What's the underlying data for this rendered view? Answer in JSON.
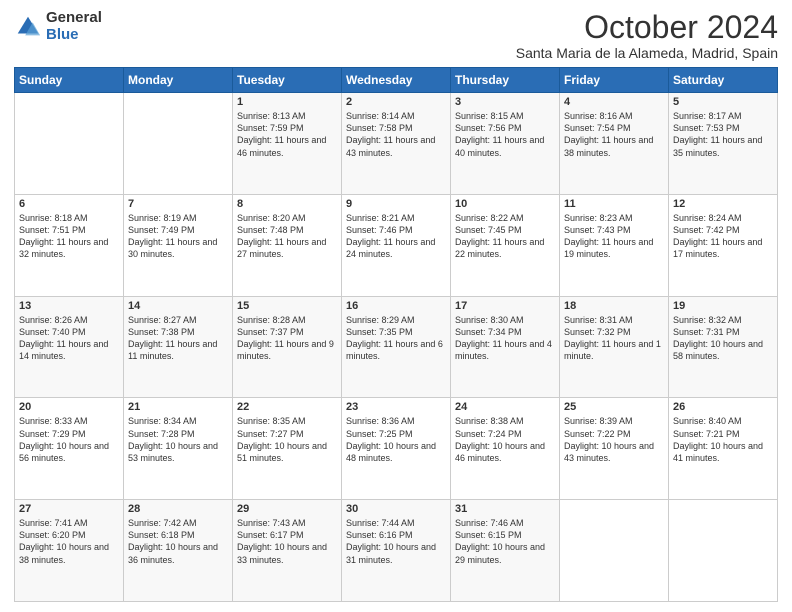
{
  "logo": {
    "general": "General",
    "blue": "Blue"
  },
  "header": {
    "month": "October 2024",
    "location": "Santa Maria de la Alameda, Madrid, Spain"
  },
  "weekdays": [
    "Sunday",
    "Monday",
    "Tuesday",
    "Wednesday",
    "Thursday",
    "Friday",
    "Saturday"
  ],
  "weeks": [
    [
      {
        "day": "",
        "info": ""
      },
      {
        "day": "",
        "info": ""
      },
      {
        "day": "1",
        "info": "Sunrise: 8:13 AM\nSunset: 7:59 PM\nDaylight: 11 hours and 46 minutes."
      },
      {
        "day": "2",
        "info": "Sunrise: 8:14 AM\nSunset: 7:58 PM\nDaylight: 11 hours and 43 minutes."
      },
      {
        "day": "3",
        "info": "Sunrise: 8:15 AM\nSunset: 7:56 PM\nDaylight: 11 hours and 40 minutes."
      },
      {
        "day": "4",
        "info": "Sunrise: 8:16 AM\nSunset: 7:54 PM\nDaylight: 11 hours and 38 minutes."
      },
      {
        "day": "5",
        "info": "Sunrise: 8:17 AM\nSunset: 7:53 PM\nDaylight: 11 hours and 35 minutes."
      }
    ],
    [
      {
        "day": "6",
        "info": "Sunrise: 8:18 AM\nSunset: 7:51 PM\nDaylight: 11 hours and 32 minutes."
      },
      {
        "day": "7",
        "info": "Sunrise: 8:19 AM\nSunset: 7:49 PM\nDaylight: 11 hours and 30 minutes."
      },
      {
        "day": "8",
        "info": "Sunrise: 8:20 AM\nSunset: 7:48 PM\nDaylight: 11 hours and 27 minutes."
      },
      {
        "day": "9",
        "info": "Sunrise: 8:21 AM\nSunset: 7:46 PM\nDaylight: 11 hours and 24 minutes."
      },
      {
        "day": "10",
        "info": "Sunrise: 8:22 AM\nSunset: 7:45 PM\nDaylight: 11 hours and 22 minutes."
      },
      {
        "day": "11",
        "info": "Sunrise: 8:23 AM\nSunset: 7:43 PM\nDaylight: 11 hours and 19 minutes."
      },
      {
        "day": "12",
        "info": "Sunrise: 8:24 AM\nSunset: 7:42 PM\nDaylight: 11 hours and 17 minutes."
      }
    ],
    [
      {
        "day": "13",
        "info": "Sunrise: 8:26 AM\nSunset: 7:40 PM\nDaylight: 11 hours and 14 minutes."
      },
      {
        "day": "14",
        "info": "Sunrise: 8:27 AM\nSunset: 7:38 PM\nDaylight: 11 hours and 11 minutes."
      },
      {
        "day": "15",
        "info": "Sunrise: 8:28 AM\nSunset: 7:37 PM\nDaylight: 11 hours and 9 minutes."
      },
      {
        "day": "16",
        "info": "Sunrise: 8:29 AM\nSunset: 7:35 PM\nDaylight: 11 hours and 6 minutes."
      },
      {
        "day": "17",
        "info": "Sunrise: 8:30 AM\nSunset: 7:34 PM\nDaylight: 11 hours and 4 minutes."
      },
      {
        "day": "18",
        "info": "Sunrise: 8:31 AM\nSunset: 7:32 PM\nDaylight: 11 hours and 1 minute."
      },
      {
        "day": "19",
        "info": "Sunrise: 8:32 AM\nSunset: 7:31 PM\nDaylight: 10 hours and 58 minutes."
      }
    ],
    [
      {
        "day": "20",
        "info": "Sunrise: 8:33 AM\nSunset: 7:29 PM\nDaylight: 10 hours and 56 minutes."
      },
      {
        "day": "21",
        "info": "Sunrise: 8:34 AM\nSunset: 7:28 PM\nDaylight: 10 hours and 53 minutes."
      },
      {
        "day": "22",
        "info": "Sunrise: 8:35 AM\nSunset: 7:27 PM\nDaylight: 10 hours and 51 minutes."
      },
      {
        "day": "23",
        "info": "Sunrise: 8:36 AM\nSunset: 7:25 PM\nDaylight: 10 hours and 48 minutes."
      },
      {
        "day": "24",
        "info": "Sunrise: 8:38 AM\nSunset: 7:24 PM\nDaylight: 10 hours and 46 minutes."
      },
      {
        "day": "25",
        "info": "Sunrise: 8:39 AM\nSunset: 7:22 PM\nDaylight: 10 hours and 43 minutes."
      },
      {
        "day": "26",
        "info": "Sunrise: 8:40 AM\nSunset: 7:21 PM\nDaylight: 10 hours and 41 minutes."
      }
    ],
    [
      {
        "day": "27",
        "info": "Sunrise: 7:41 AM\nSunset: 6:20 PM\nDaylight: 10 hours and 38 minutes."
      },
      {
        "day": "28",
        "info": "Sunrise: 7:42 AM\nSunset: 6:18 PM\nDaylight: 10 hours and 36 minutes."
      },
      {
        "day": "29",
        "info": "Sunrise: 7:43 AM\nSunset: 6:17 PM\nDaylight: 10 hours and 33 minutes."
      },
      {
        "day": "30",
        "info": "Sunrise: 7:44 AM\nSunset: 6:16 PM\nDaylight: 10 hours and 31 minutes."
      },
      {
        "day": "31",
        "info": "Sunrise: 7:46 AM\nSunset: 6:15 PM\nDaylight: 10 hours and 29 minutes."
      },
      {
        "day": "",
        "info": ""
      },
      {
        "day": "",
        "info": ""
      }
    ]
  ]
}
